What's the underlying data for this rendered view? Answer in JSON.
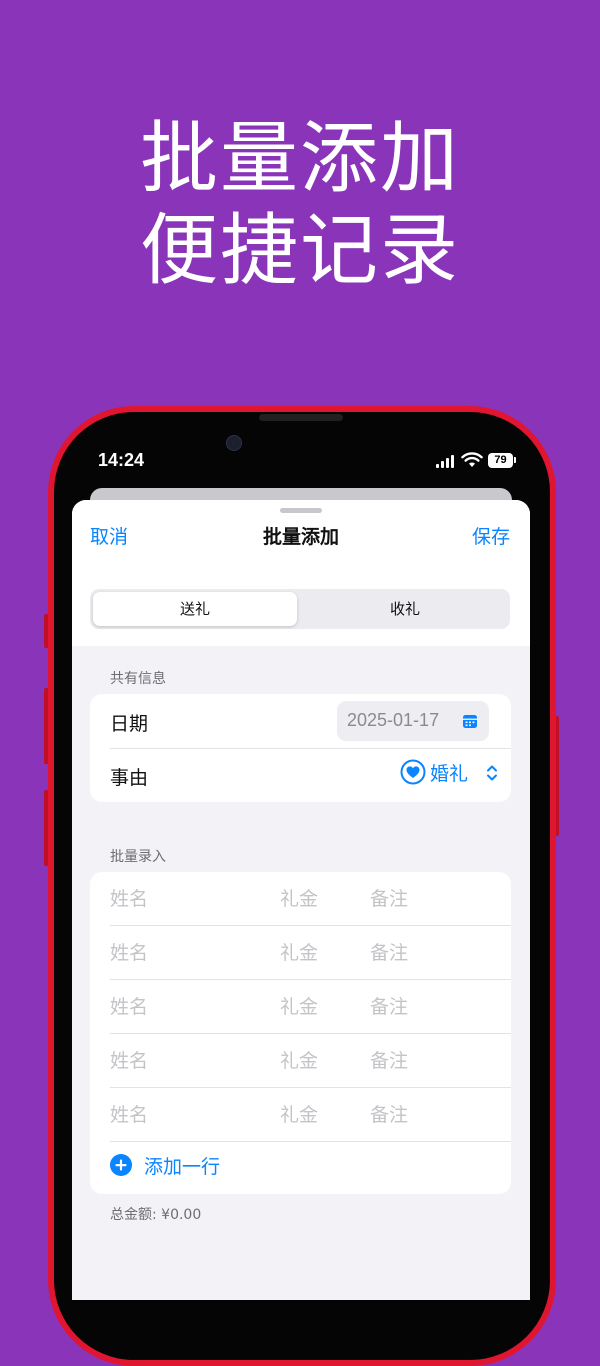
{
  "promo": {
    "line1": "批量添加",
    "line2": "便捷记录"
  },
  "status_bar": {
    "time": "14:24",
    "battery": "79"
  },
  "nav": {
    "cancel": "取消",
    "title": "批量添加",
    "save": "保存"
  },
  "segment": {
    "options": [
      "送礼",
      "收礼"
    ],
    "selected": "送礼"
  },
  "shared": {
    "header": "共有信息",
    "date_label": "日期",
    "date_value": "2025-01-17",
    "reason_label": "事由",
    "reason_value": "婚礼"
  },
  "batch": {
    "header": "批量录入",
    "placeholders": {
      "name": "姓名",
      "amount": "礼金",
      "note": "备注"
    },
    "add_row": "添加一行",
    "total": "总金额: ¥0.00"
  },
  "colors": {
    "background": "#8a35b9",
    "accent": "#0a84ff",
    "phone_frame": "#e0152f"
  },
  "icons": [
    "signal-icon",
    "wifi-icon",
    "battery-icon",
    "calendar-icon",
    "heart-icon",
    "chevron-updown-icon",
    "plus-circle-icon"
  ]
}
